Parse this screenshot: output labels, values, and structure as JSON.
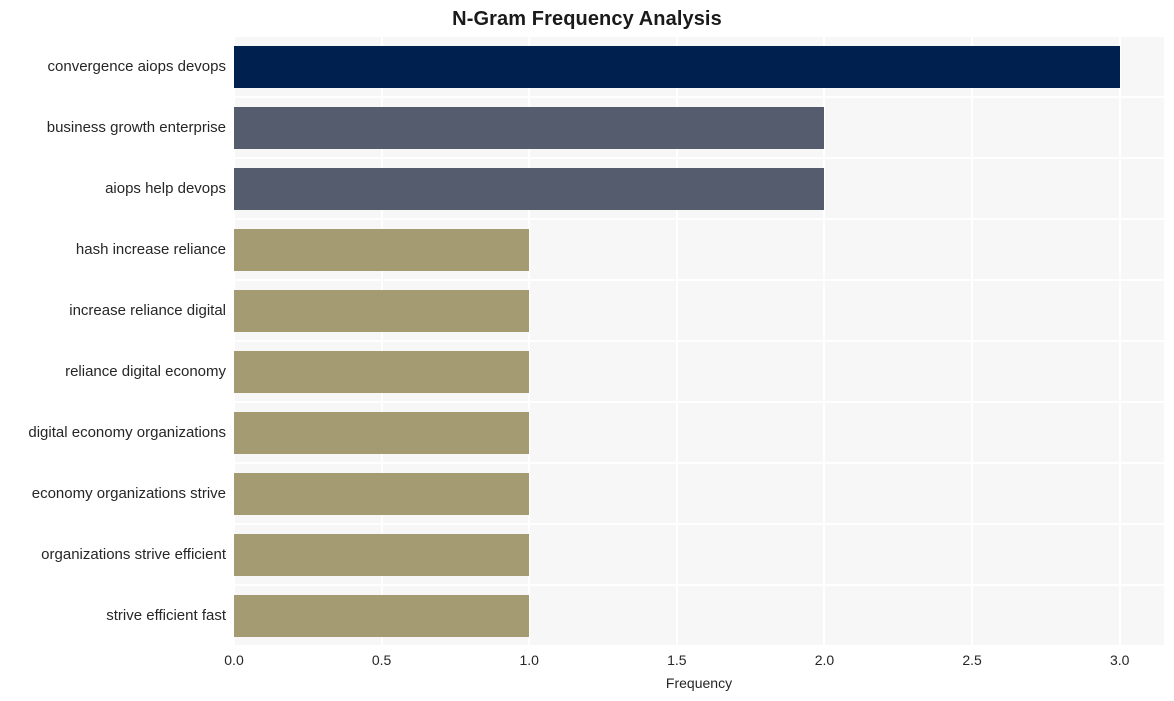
{
  "chart_data": {
    "type": "bar",
    "orientation": "horizontal",
    "title": "N-Gram Frequency Analysis",
    "xlabel": "Frequency",
    "ylabel": "",
    "xlim": [
      0.0,
      3.15
    ],
    "ylim": [
      0,
      10
    ],
    "grid": true,
    "legend": null,
    "xticks": [
      "0.0",
      "0.5",
      "1.0",
      "1.5",
      "2.0",
      "2.5",
      "3.0"
    ],
    "xtick_values": [
      0.0,
      0.5,
      1.0,
      1.5,
      2.0,
      2.5,
      3.0
    ],
    "categories": [
      "convergence aiops devops",
      "business growth enterprise",
      "aiops help devops",
      "hash increase reliance",
      "increase reliance digital",
      "reliance digital economy",
      "digital economy organizations",
      "economy organizations strive",
      "organizations strive efficient",
      "strive efficient fast"
    ],
    "values": [
      3,
      2,
      2,
      1,
      1,
      1,
      1,
      1,
      1,
      1
    ],
    "bar_colors": [
      "#002050",
      "#555c6e",
      "#555c6e",
      "#a49b72",
      "#a49b72",
      "#a49b72",
      "#a49b72",
      "#a49b72",
      "#a49b72",
      "#a49b72"
    ]
  },
  "style": {
    "figure_background": "#ffffff",
    "plot_background": "#f7f7f7",
    "grid_color": "#ffffff",
    "text_color": "#262626",
    "title_color": "#1a1a1a"
  }
}
